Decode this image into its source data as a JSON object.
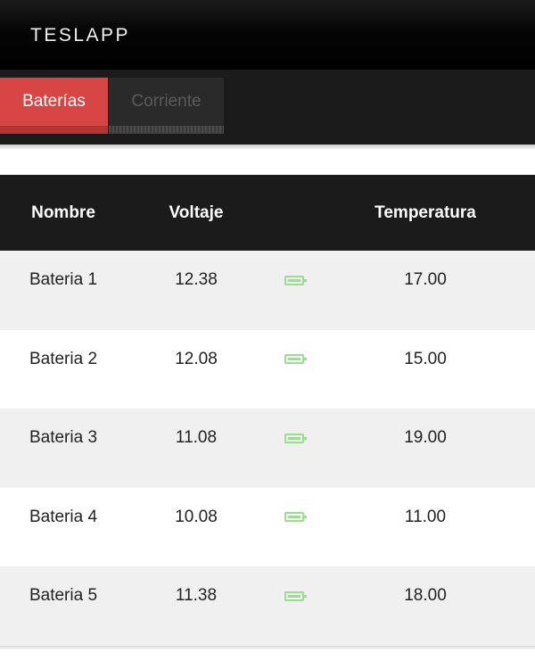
{
  "app": {
    "brand": "TESLAPP"
  },
  "tabs": [
    {
      "label": "Baterías",
      "active": true
    },
    {
      "label": "Corriente",
      "active": false
    }
  ],
  "table": {
    "headers": {
      "name": "Nombre",
      "voltage": "Voltaje",
      "status": "",
      "temperature": "Temperatura"
    },
    "rows": [
      {
        "name": "Bateria 1",
        "voltage": "12.38",
        "status_icon": "battery-full-icon",
        "temperature": "17.00"
      },
      {
        "name": "Bateria 2",
        "voltage": "12.08",
        "status_icon": "battery-full-icon",
        "temperature": "15.00"
      },
      {
        "name": "Bateria 3",
        "voltage": "11.08",
        "status_icon": "battery-full-icon",
        "temperature": "19.00"
      },
      {
        "name": "Bateria 4",
        "voltage": "10.08",
        "status_icon": "battery-full-icon",
        "temperature": "11.00"
      },
      {
        "name": "Bateria 5",
        "voltage": "11.38",
        "status_icon": "battery-full-icon",
        "temperature": "18.00"
      }
    ]
  },
  "colors": {
    "accent": "#d74545",
    "battery_ok": "#98df8e",
    "header_bg": "#1b1b1b"
  }
}
